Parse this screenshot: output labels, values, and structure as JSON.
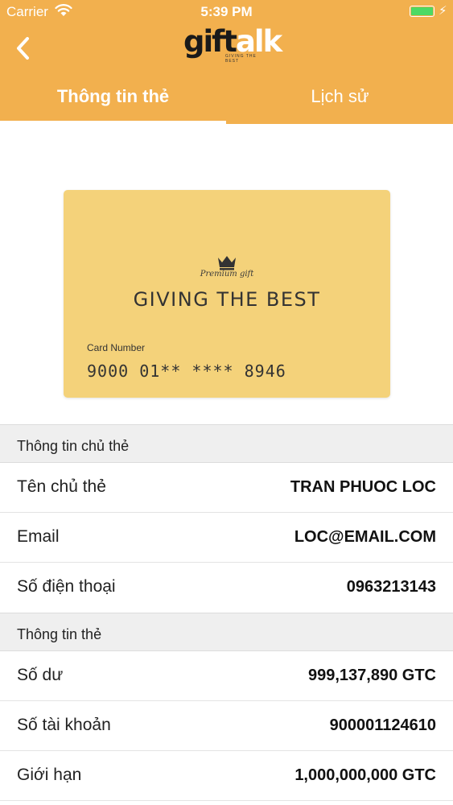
{
  "status_bar": {
    "carrier": "Carrier",
    "time": "5:39 PM",
    "wifi_icon": "wifi-icon",
    "battery_icon": "battery-icon",
    "battery_color": "#4cd964",
    "charging_icon": "charging-bolt-icon"
  },
  "header": {
    "back_icon": "chevron-left-icon",
    "logo_gift": "gift",
    "logo_alk": "alk",
    "logo_tagline": "GIVING THE BEST",
    "background_color": "#f2b04e"
  },
  "tabs": [
    {
      "label": "Thông tin thẻ",
      "selected": true
    },
    {
      "label": "Lịch sử",
      "selected": false
    }
  ],
  "card": {
    "background_color": "#f4d27a",
    "crown_icon": "crown-icon",
    "premium_label": "Premium gift",
    "slogan": "GIVING THE BEST",
    "number_label": "Card Number",
    "number": "9000 01** **** 8946"
  },
  "holder_section": {
    "title": "Thông tin chủ thẻ",
    "rows": [
      {
        "label": "Tên chủ thẻ",
        "value": "TRAN PHUOC LOC"
      },
      {
        "label": "Email",
        "value": "LOC@EMAIL.COM"
      },
      {
        "label": "Số điện thoại",
        "value": "0963213143"
      }
    ]
  },
  "card_section": {
    "title": "Thông tin thẻ",
    "rows": [
      {
        "label": "Số dư",
        "value": "999,137,890 GTC"
      },
      {
        "label": "Số tài khoản",
        "value": "900001124610"
      },
      {
        "label": "Giới hạn",
        "value": "1,000,000,000 GTC"
      }
    ]
  }
}
